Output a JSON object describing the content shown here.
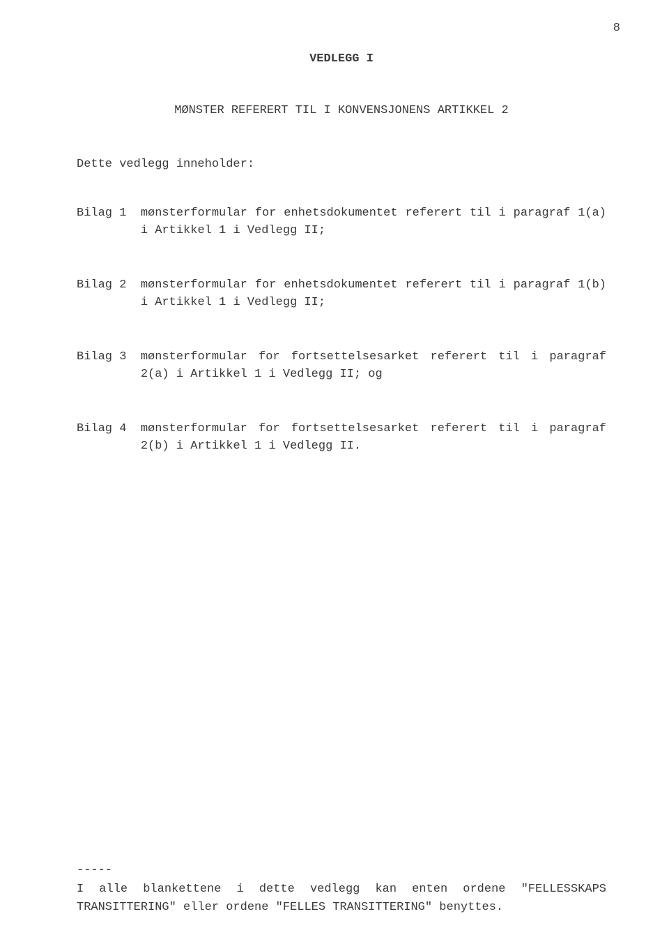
{
  "page_number": "8",
  "title": "VEDLEGG I",
  "subtitle": "MØNSTER REFERERT TIL I KONVENSJONENS ARTIKKEL 2",
  "intro": "Dette vedlegg inneholder:",
  "bilag": [
    {
      "label": "Bilag 1  ",
      "text": "mønsterformular for enhetsdokumentet referert til i paragraf 1(a) i Artikkel 1 i Vedlegg II;"
    },
    {
      "label": "Bilag 2  ",
      "text": "mønsterformular for enhetsdokumentet referert til i paragraf 1(b) i Artikkel 1 i Vedlegg II;"
    },
    {
      "label": "Bilag 3  ",
      "text": "mønsterformular for fortsettelsesarket referert til i paragraf 2(a) i Artikkel 1 i Vedlegg II; og"
    },
    {
      "label": "Bilag 4  ",
      "text": "mønsterformular for fortsettelsesarket referert til i paragraf 2(b) i Artikkel 1 i Vedlegg II."
    }
  ],
  "footnote": {
    "dashes": "-----",
    "text": "I alle blankettene i dette vedlegg kan enten ordene \"FELLESSKAPS TRANSITTERING\" eller ordene \"FELLES TRANSITTERING\" benyttes."
  }
}
